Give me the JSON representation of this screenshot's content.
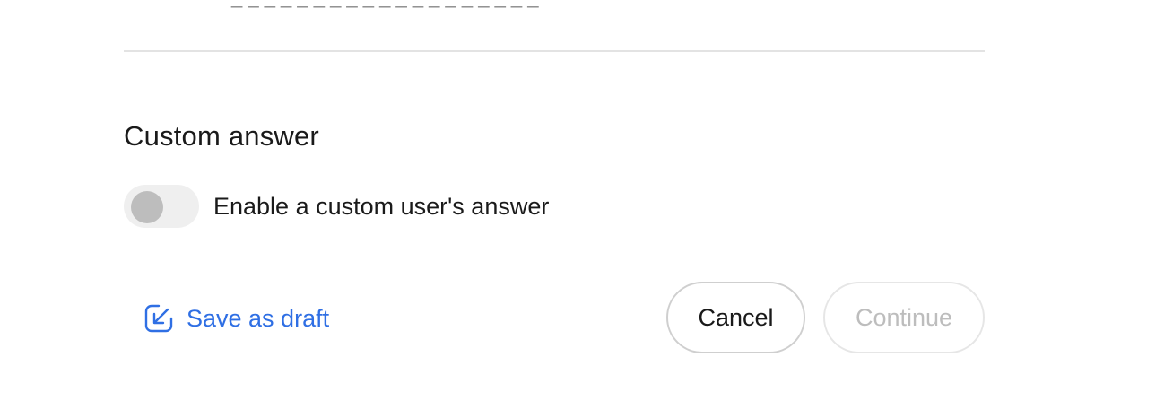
{
  "cutoff_text": "_ _ _ _ _ _ _ _ _ _ _ _ _ _ _ _ _ _ _",
  "custom_answer": {
    "title": "Custom answer",
    "toggle_label": "Enable a custom user's answer",
    "toggle_on": false
  },
  "actions": {
    "save_draft_label": "Save as draft",
    "save_draft_icon": "arrow-down-left-square-icon",
    "cancel_label": "Cancel",
    "continue_label": "Continue",
    "continue_disabled": true
  },
  "colors": {
    "link_blue": "#2f6fe4",
    "disabled_text": "#bdbdbd",
    "toggle_track": "#efefef",
    "toggle_knob": "#bdbdbd"
  }
}
